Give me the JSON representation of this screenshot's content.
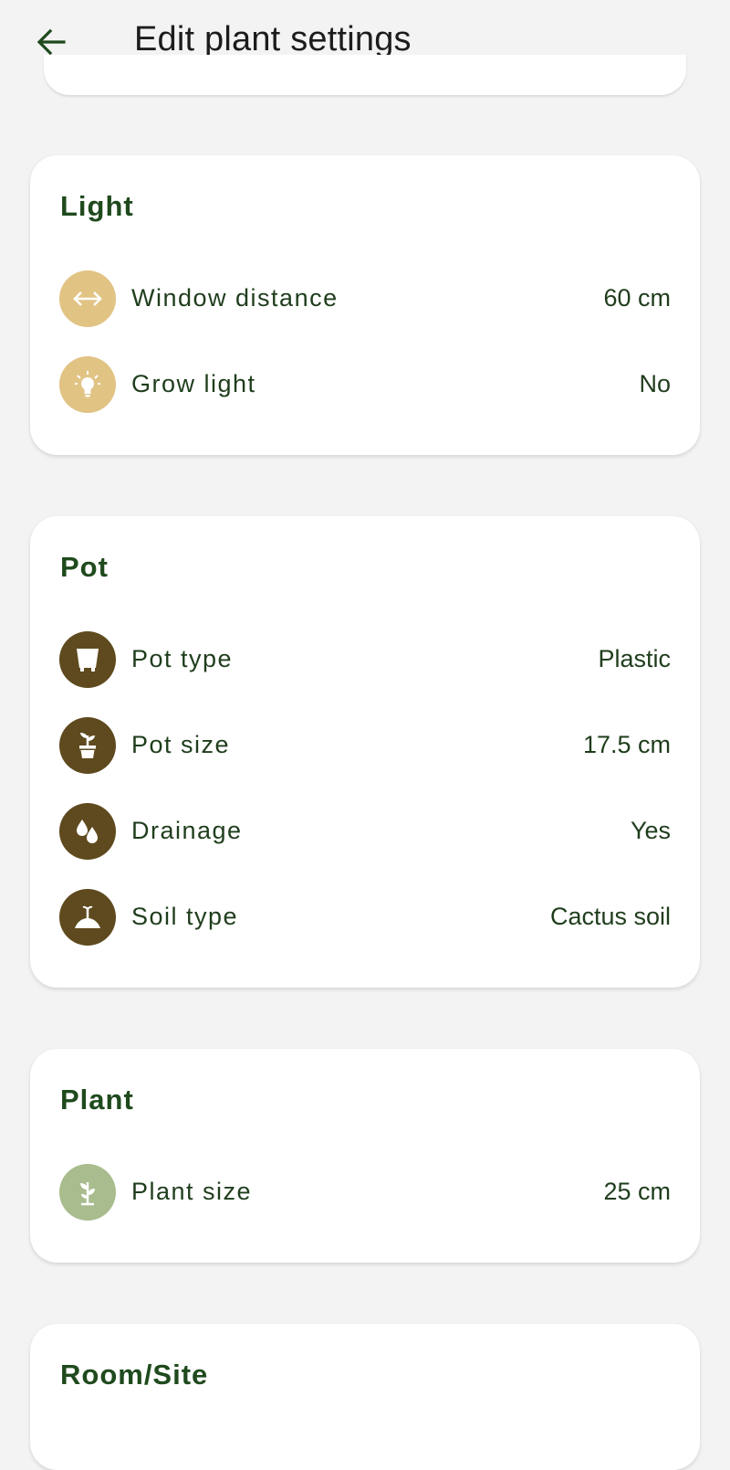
{
  "header": {
    "title": "Edit plant settings"
  },
  "sections": [
    {
      "title": "Light",
      "rows": [
        {
          "label": "Window distance",
          "value": "60 cm",
          "icon": "arrows-horizontal-icon"
        },
        {
          "label": "Grow light",
          "value": "No",
          "icon": "lightbulb-icon"
        }
      ]
    },
    {
      "title": "Pot",
      "rows": [
        {
          "label": "Pot type",
          "value": "Plastic",
          "icon": "pot-icon"
        },
        {
          "label": "Pot size",
          "value": "17.5 cm",
          "icon": "potted-plant-icon"
        },
        {
          "label": "Drainage",
          "value": "Yes",
          "icon": "water-drops-icon"
        },
        {
          "label": "Soil type",
          "value": "Cactus soil",
          "icon": "soil-icon"
        }
      ]
    },
    {
      "title": "Plant",
      "rows": [
        {
          "label": "Plant size",
          "value": "25 cm",
          "icon": "sprout-icon"
        }
      ]
    },
    {
      "title": "Room/Site",
      "rows": []
    }
  ],
  "colors": {
    "light_icon_bg": "#e1c384",
    "pot_icon_bg": "#5e4a1e",
    "plant_icon_bg": "#a9bc8e",
    "title_green": "#1f4a1d"
  }
}
